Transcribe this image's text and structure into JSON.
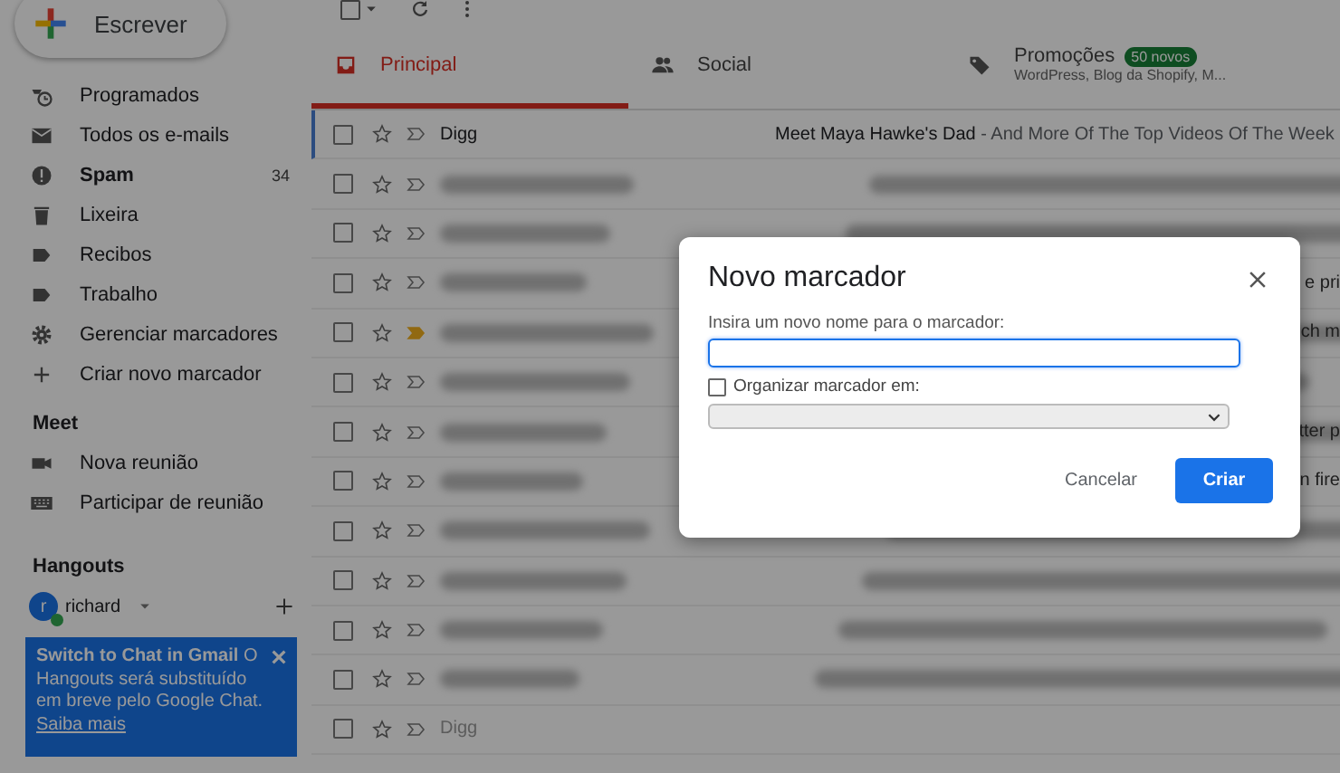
{
  "compose": {
    "label": "Escrever"
  },
  "sidebar": {
    "items": [
      {
        "label": "Programados",
        "bold": false
      },
      {
        "label": "Todos os e-mails",
        "bold": false
      },
      {
        "label": "Spam",
        "bold": true,
        "count": "34"
      },
      {
        "label": "Lixeira",
        "bold": false
      },
      {
        "label": "Recibos",
        "bold": false
      },
      {
        "label": "Trabalho",
        "bold": false
      },
      {
        "label": "Gerenciar marcadores",
        "bold": false
      },
      {
        "label": "Criar novo marcador",
        "bold": false
      }
    ]
  },
  "meet": {
    "title": "Meet",
    "items": [
      {
        "label": "Nova reunião"
      },
      {
        "label": "Participar de reunião"
      }
    ]
  },
  "hangouts": {
    "title": "Hangouts",
    "user": {
      "initial": "r",
      "name": "richard",
      "online": true
    },
    "banner": {
      "title": "Switch to Chat in Gmail",
      "text": "O Hangouts será substituído em breve pelo Google Chat.",
      "link": "Saiba mais"
    }
  },
  "select_all_checked": false,
  "tabs": [
    {
      "label": "Principal",
      "selected": true
    },
    {
      "label": "Social",
      "selected": false
    },
    {
      "label": "Promoções",
      "selected": false,
      "badge": "50 novos",
      "subtitle": "WordPress, Blog da Shopify, M..."
    }
  ],
  "rows": [
    {
      "kind": "clear",
      "checked": false,
      "sender": "Digg",
      "subject": "Meet Maya Hawke's Dad",
      "snippet": "- And More Of The Top Videos Of The Week",
      "important": false
    },
    {
      "kind": "blurred",
      "checked": false,
      "important": false
    },
    {
      "kind": "blurred",
      "checked": false,
      "important": false
    },
    {
      "kind": "blurred",
      "checked": false,
      "important": false,
      "tail": "e pri"
    },
    {
      "kind": "blurred",
      "checked": false,
      "important": true,
      "tail": "ch m"
    },
    {
      "kind": "blurred",
      "checked": false,
      "important": false
    },
    {
      "kind": "blurred",
      "checked": false,
      "important": false,
      "tail": "tter p"
    },
    {
      "kind": "blurred",
      "checked": false,
      "important": false,
      "tail": "n fire"
    },
    {
      "kind": "blurred",
      "checked": false,
      "important": false
    },
    {
      "kind": "blurred",
      "checked": false,
      "important": false
    },
    {
      "kind": "blurred",
      "checked": false,
      "important": false
    },
    {
      "kind": "blurred",
      "checked": false,
      "important": false
    },
    {
      "kind": "faint",
      "checked": false,
      "sender": "Digg",
      "important": false
    }
  ],
  "dialog": {
    "title": "Novo marcador",
    "name_label": "Insira um novo nome para o marcador:",
    "nest_label": "Organizar marcador em:",
    "nest_checked": false,
    "buttons": [
      {
        "kind": "text",
        "label": "Cancelar"
      },
      {
        "kind": "primary",
        "label": "Criar"
      }
    ]
  }
}
